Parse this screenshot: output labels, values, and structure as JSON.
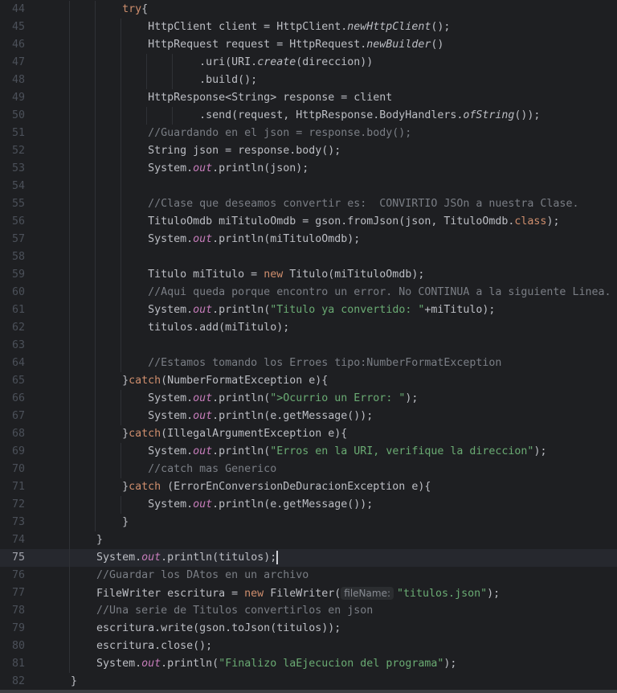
{
  "editor": {
    "current_line": 75,
    "lines": [
      {
        "n": "44",
        "seg": [
          [
            "k",
            "            try"
          ],
          [
            "t",
            "{"
          ]
        ]
      },
      {
        "n": "45",
        "seg": [
          [
            "t",
            "                HttpClient client = HttpClient."
          ],
          [
            "i",
            "newHttpClient"
          ],
          [
            "t",
            "();"
          ]
        ]
      },
      {
        "n": "46",
        "seg": [
          [
            "t",
            "                HttpRequest request = HttpRequest."
          ],
          [
            "i",
            "newBuilder"
          ],
          [
            "t",
            "()"
          ]
        ]
      },
      {
        "n": "47",
        "seg": [
          [
            "t",
            "                        .uri(URI."
          ],
          [
            "i",
            "create"
          ],
          [
            "t",
            "(direccion))"
          ]
        ]
      },
      {
        "n": "48",
        "seg": [
          [
            "t",
            "                        .build();"
          ]
        ]
      },
      {
        "n": "49",
        "seg": [
          [
            "t",
            "                HttpResponse<String> response = client"
          ]
        ]
      },
      {
        "n": "50",
        "seg": [
          [
            "t",
            "                        .send(request, HttpResponse.BodyHandlers."
          ],
          [
            "i",
            "ofString"
          ],
          [
            "t",
            "());"
          ]
        ]
      },
      {
        "n": "51",
        "seg": [
          [
            "c",
            "                //Guardando en el json = response.body();"
          ]
        ]
      },
      {
        "n": "52",
        "seg": [
          [
            "t",
            "                String json = response.body();"
          ]
        ]
      },
      {
        "n": "53",
        "seg": [
          [
            "t",
            "                System."
          ],
          [
            "f",
            "out"
          ],
          [
            "t",
            ".println(json);"
          ]
        ]
      },
      {
        "n": "54",
        "seg": []
      },
      {
        "n": "55",
        "seg": [
          [
            "c",
            "                //Clase que deseamos convertir es:  CONVIRTIO JSOn a nuestra Clase."
          ]
        ]
      },
      {
        "n": "56",
        "seg": [
          [
            "t",
            "                TituloOmdb miTituloOmdb = gson.fromJson(json, TituloOmdb."
          ],
          [
            "k",
            "class"
          ],
          [
            "t",
            ");"
          ]
        ]
      },
      {
        "n": "57",
        "seg": [
          [
            "t",
            "                System."
          ],
          [
            "f",
            "out"
          ],
          [
            "t",
            ".println(miTituloOmdb);"
          ]
        ]
      },
      {
        "n": "58",
        "seg": []
      },
      {
        "n": "59",
        "seg": [
          [
            "t",
            "                Titulo miTitulo = "
          ],
          [
            "k",
            "new"
          ],
          [
            "t",
            " Titulo(miTituloOmdb);"
          ]
        ]
      },
      {
        "n": "60",
        "seg": [
          [
            "c",
            "                //Aqui queda porque encontro un error. No CONTINUA a la siguiente Linea."
          ]
        ]
      },
      {
        "n": "61",
        "seg": [
          [
            "t",
            "                System."
          ],
          [
            "f",
            "out"
          ],
          [
            "t",
            ".println("
          ],
          [
            "s",
            "\"Titulo ya convertido: \""
          ],
          [
            "t",
            "+miTitulo);"
          ]
        ]
      },
      {
        "n": "62",
        "seg": [
          [
            "t",
            "                titulos.add(miTitulo);"
          ]
        ]
      },
      {
        "n": "63",
        "seg": []
      },
      {
        "n": "64",
        "seg": [
          [
            "c",
            "                //Estamos tomando los Erroes tipo:NumberFormatException"
          ]
        ]
      },
      {
        "n": "65",
        "seg": [
          [
            "t",
            "            }"
          ],
          [
            "k",
            "catch"
          ],
          [
            "t",
            "(NumberFormatException e){"
          ]
        ]
      },
      {
        "n": "66",
        "seg": [
          [
            "t",
            "                System."
          ],
          [
            "f",
            "out"
          ],
          [
            "t",
            ".println("
          ],
          [
            "s",
            "\">Ocurrio un Error: \""
          ],
          [
            "t",
            ");"
          ]
        ]
      },
      {
        "n": "67",
        "seg": [
          [
            "t",
            "                System."
          ],
          [
            "f",
            "out"
          ],
          [
            "t",
            ".println(e.getMessage());"
          ]
        ]
      },
      {
        "n": "68",
        "seg": [
          [
            "t",
            "            }"
          ],
          [
            "k",
            "catch"
          ],
          [
            "t",
            "(IllegalArgumentException e){"
          ]
        ]
      },
      {
        "n": "69",
        "seg": [
          [
            "t",
            "                System."
          ],
          [
            "f",
            "out"
          ],
          [
            "t",
            ".println("
          ],
          [
            "s",
            "\"Erros en la URI, verifique la direccion\""
          ],
          [
            "t",
            ");"
          ]
        ]
      },
      {
        "n": "70",
        "seg": [
          [
            "c",
            "                //catch mas Generico"
          ]
        ]
      },
      {
        "n": "71",
        "seg": [
          [
            "t",
            "            }"
          ],
          [
            "k",
            "catch"
          ],
          [
            "t",
            " (ErrorEnConversionDeDuracionException e){"
          ]
        ]
      },
      {
        "n": "72",
        "seg": [
          [
            "t",
            "                System."
          ],
          [
            "f",
            "out"
          ],
          [
            "t",
            ".println(e.getMessage());"
          ]
        ]
      },
      {
        "n": "73",
        "seg": [
          [
            "t",
            "            }"
          ]
        ]
      },
      {
        "n": "74",
        "seg": [
          [
            "t",
            "        }"
          ]
        ]
      },
      {
        "n": "75",
        "seg": [
          [
            "t",
            "        System."
          ],
          [
            "f",
            "out"
          ],
          [
            "t",
            ".println(titulos);"
          ]
        ]
      },
      {
        "n": "76",
        "seg": [
          [
            "c",
            "        //Guardar los DAtos en un archivo"
          ]
        ]
      },
      {
        "n": "77",
        "seg": [
          [
            "t",
            "        FileWriter escritura = "
          ],
          [
            "k",
            "new"
          ],
          [
            "t",
            " FileWriter("
          ],
          [
            "h",
            "fileName:"
          ],
          [
            "s",
            "\"titulos.json\""
          ],
          [
            "t",
            ");"
          ]
        ]
      },
      {
        "n": "78",
        "seg": [
          [
            "c",
            "        //Una serie de Titulos convertirlos en json"
          ]
        ]
      },
      {
        "n": "79",
        "seg": [
          [
            "t",
            "        escritura.write(gson.toJson(titulos));"
          ]
        ]
      },
      {
        "n": "80",
        "seg": [
          [
            "t",
            "        escritura.close();"
          ]
        ]
      },
      {
        "n": "81",
        "seg": [
          [
            "t",
            "        System."
          ],
          [
            "f",
            "out"
          ],
          [
            "t",
            ".println("
          ],
          [
            "s",
            "\"Finalizo laEjecucion del programa\""
          ],
          [
            "t",
            ");"
          ]
        ]
      },
      {
        "n": "82",
        "seg": [
          [
            "t",
            "    }"
          ]
        ]
      }
    ]
  }
}
